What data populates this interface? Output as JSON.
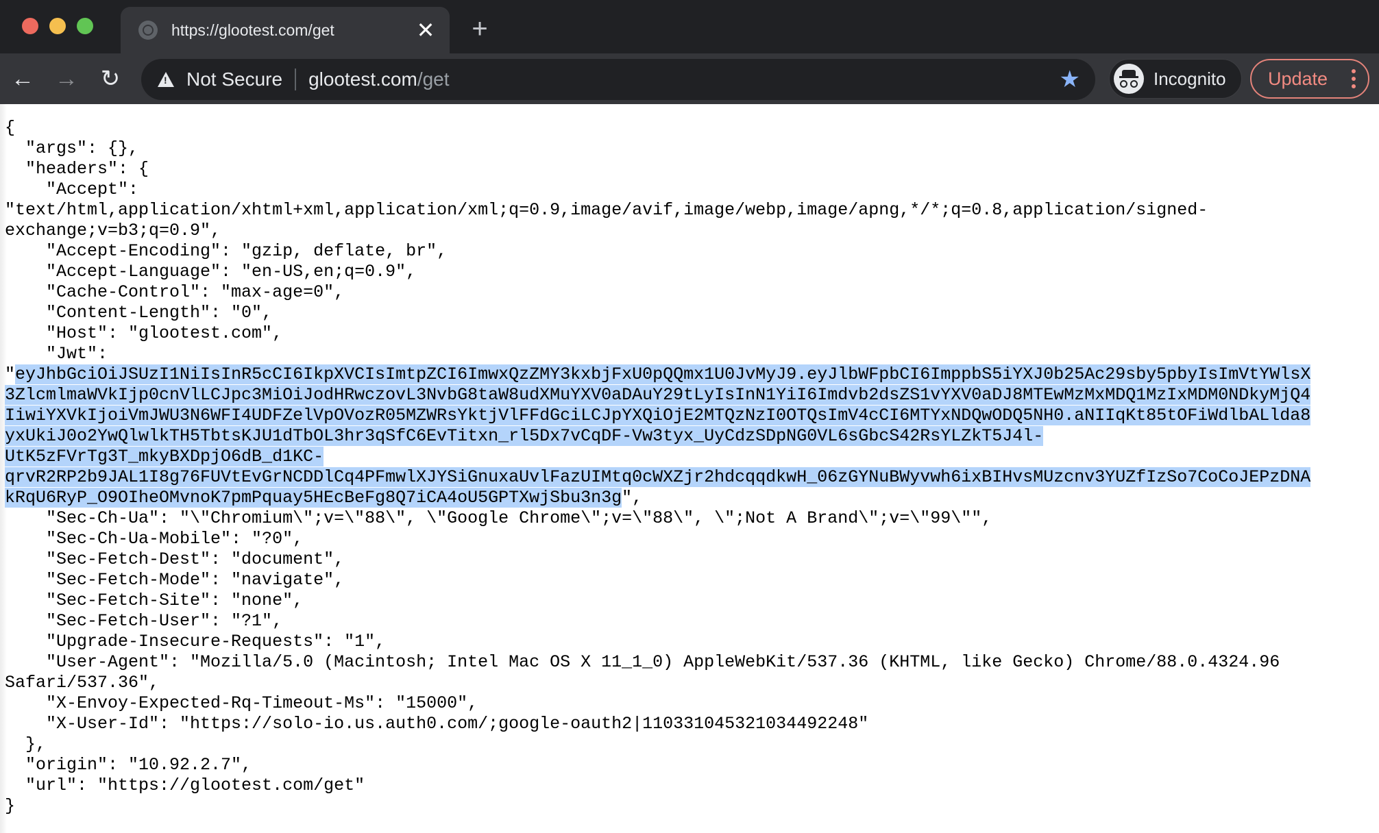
{
  "window": {
    "traffic_lights": [
      "close",
      "minimize",
      "maximize"
    ]
  },
  "tab": {
    "title": "https://glootest.com/get",
    "favicon": "globe-icon",
    "close_glyph": "✕"
  },
  "new_tab_glyph": "+",
  "toolbar": {
    "back_glyph": "←",
    "forward_glyph": "→",
    "reload_glyph": "↻",
    "security_label": "Not Secure",
    "url_host": "glootest.com",
    "url_path": "/get",
    "bookmark_glyph": "★",
    "incognito_label": "Incognito",
    "update_label": "Update"
  },
  "colors": {
    "tabstrip_bg": "#202124",
    "toolbar_bg": "#35363a",
    "update_accent": "#f28b82",
    "bookmark_star": "#8ab4f8",
    "selection": "#b4d4fb"
  },
  "body": {
    "lines": [
      "{",
      "  \"args\": {},",
      "  \"headers\": {",
      "    \"Accept\":",
      "\"text/html,application/xhtml+xml,application/xml;q=0.9,image/avif,image/webp,image/apng,*/*;q=0.8,application/signed-",
      "exchange;v=b3;q=0.9\",",
      "    \"Accept-Encoding\": \"gzip, deflate, br\",",
      "    \"Accept-Language\": \"en-US,en;q=0.9\",",
      "    \"Cache-Control\": \"max-age=0\",",
      "    \"Content-Length\": \"0\",",
      "    \"Host\": \"glootest.com\",",
      "    \"Jwt\":"
    ],
    "jwt_open_quote": "\"",
    "jwt_lines": [
      "eyJhbGciOiJSUzI1NiIsInR5cCI6IkpXVCIsImtpZCI6ImwxQzZMY3kxbjFxU0pQQmx1U0JvMyJ9.eyJlbWFpbCI6ImppbS5iYXJ0b25Ac29sby5pbyIsImVtYWlsX",
      "3ZlcmlmaWVkIjp0cnVlLCJpc3MiOiJodHRwczovL3NvbG8taW8udXMuYXV0aDAuY29tLyIsInN1YiI6Imdvb2dsZS1vYXV0aDJ8MTEwMzMxMDQ1MzIxMDM0NDkyMjQ4",
      "IiwiYXVkIjoiVmJWU3N6WFI4UDFZelVpOVozR05MZWRsYktjVlFFdGciLCJpYXQiOjE2MTQzNzI0OTQsImV4cCI6MTYxNDQwODQ5NH0.aNIIqKt85tOFiWdlbALlda8",
      "yxUkiJ0o2YwQlwlkTH5TbtsKJU1dTbOL3hr3qSfC6EvTitxn_rl5Dx7vCqDF-Vw3tyx_UyCdzSDpNG0VL6sGbcS42RsYLZkT5J4l-",
      "UtK5zFVrTg3T_mkyBXDpjO6dB_d1KC-",
      "qrvR2RP2b9JAL1I8g76FUVtEvGrNCDDlCq4PFmwlXJYSiGnuxaUvlFazUIMtq0cWXZjr2hdcqqdkwH_06zGYNuBWyvwh6ixBIHvsMUzcnv3YUZfIzSo7CoCoJEPzDNA",
      "kRqU6RyP_O9OIheOMvnoK7pmPquay5HEcBeFg8Q7iCA4oU5GPTXwjSbu3n3g"
    ],
    "jwt_close": "\",",
    "lines_after": [
      "    \"Sec-Ch-Ua\": \"\\\"Chromium\\\";v=\\\"88\\\", \\\"Google Chrome\\\";v=\\\"88\\\", \\\";Not A Brand\\\";v=\\\"99\\\"\",",
      "    \"Sec-Ch-Ua-Mobile\": \"?0\",",
      "    \"Sec-Fetch-Dest\": \"document\",",
      "    \"Sec-Fetch-Mode\": \"navigate\",",
      "    \"Sec-Fetch-Site\": \"none\",",
      "    \"Sec-Fetch-User\": \"?1\",",
      "    \"Upgrade-Insecure-Requests\": \"1\",",
      "    \"User-Agent\": \"Mozilla/5.0 (Macintosh; Intel Mac OS X 11_1_0) AppleWebKit/537.36 (KHTML, like Gecko) Chrome/88.0.4324.96",
      "Safari/537.36\",",
      "    \"X-Envoy-Expected-Rq-Timeout-Ms\": \"15000\",",
      "    \"X-User-Id\": \"https://solo-io.us.auth0.com/;google-oauth2|110331045321034492248\"",
      "  },",
      "  \"origin\": \"10.92.2.7\",",
      "  \"url\": \"https://glootest.com/get\"",
      "}"
    ]
  }
}
